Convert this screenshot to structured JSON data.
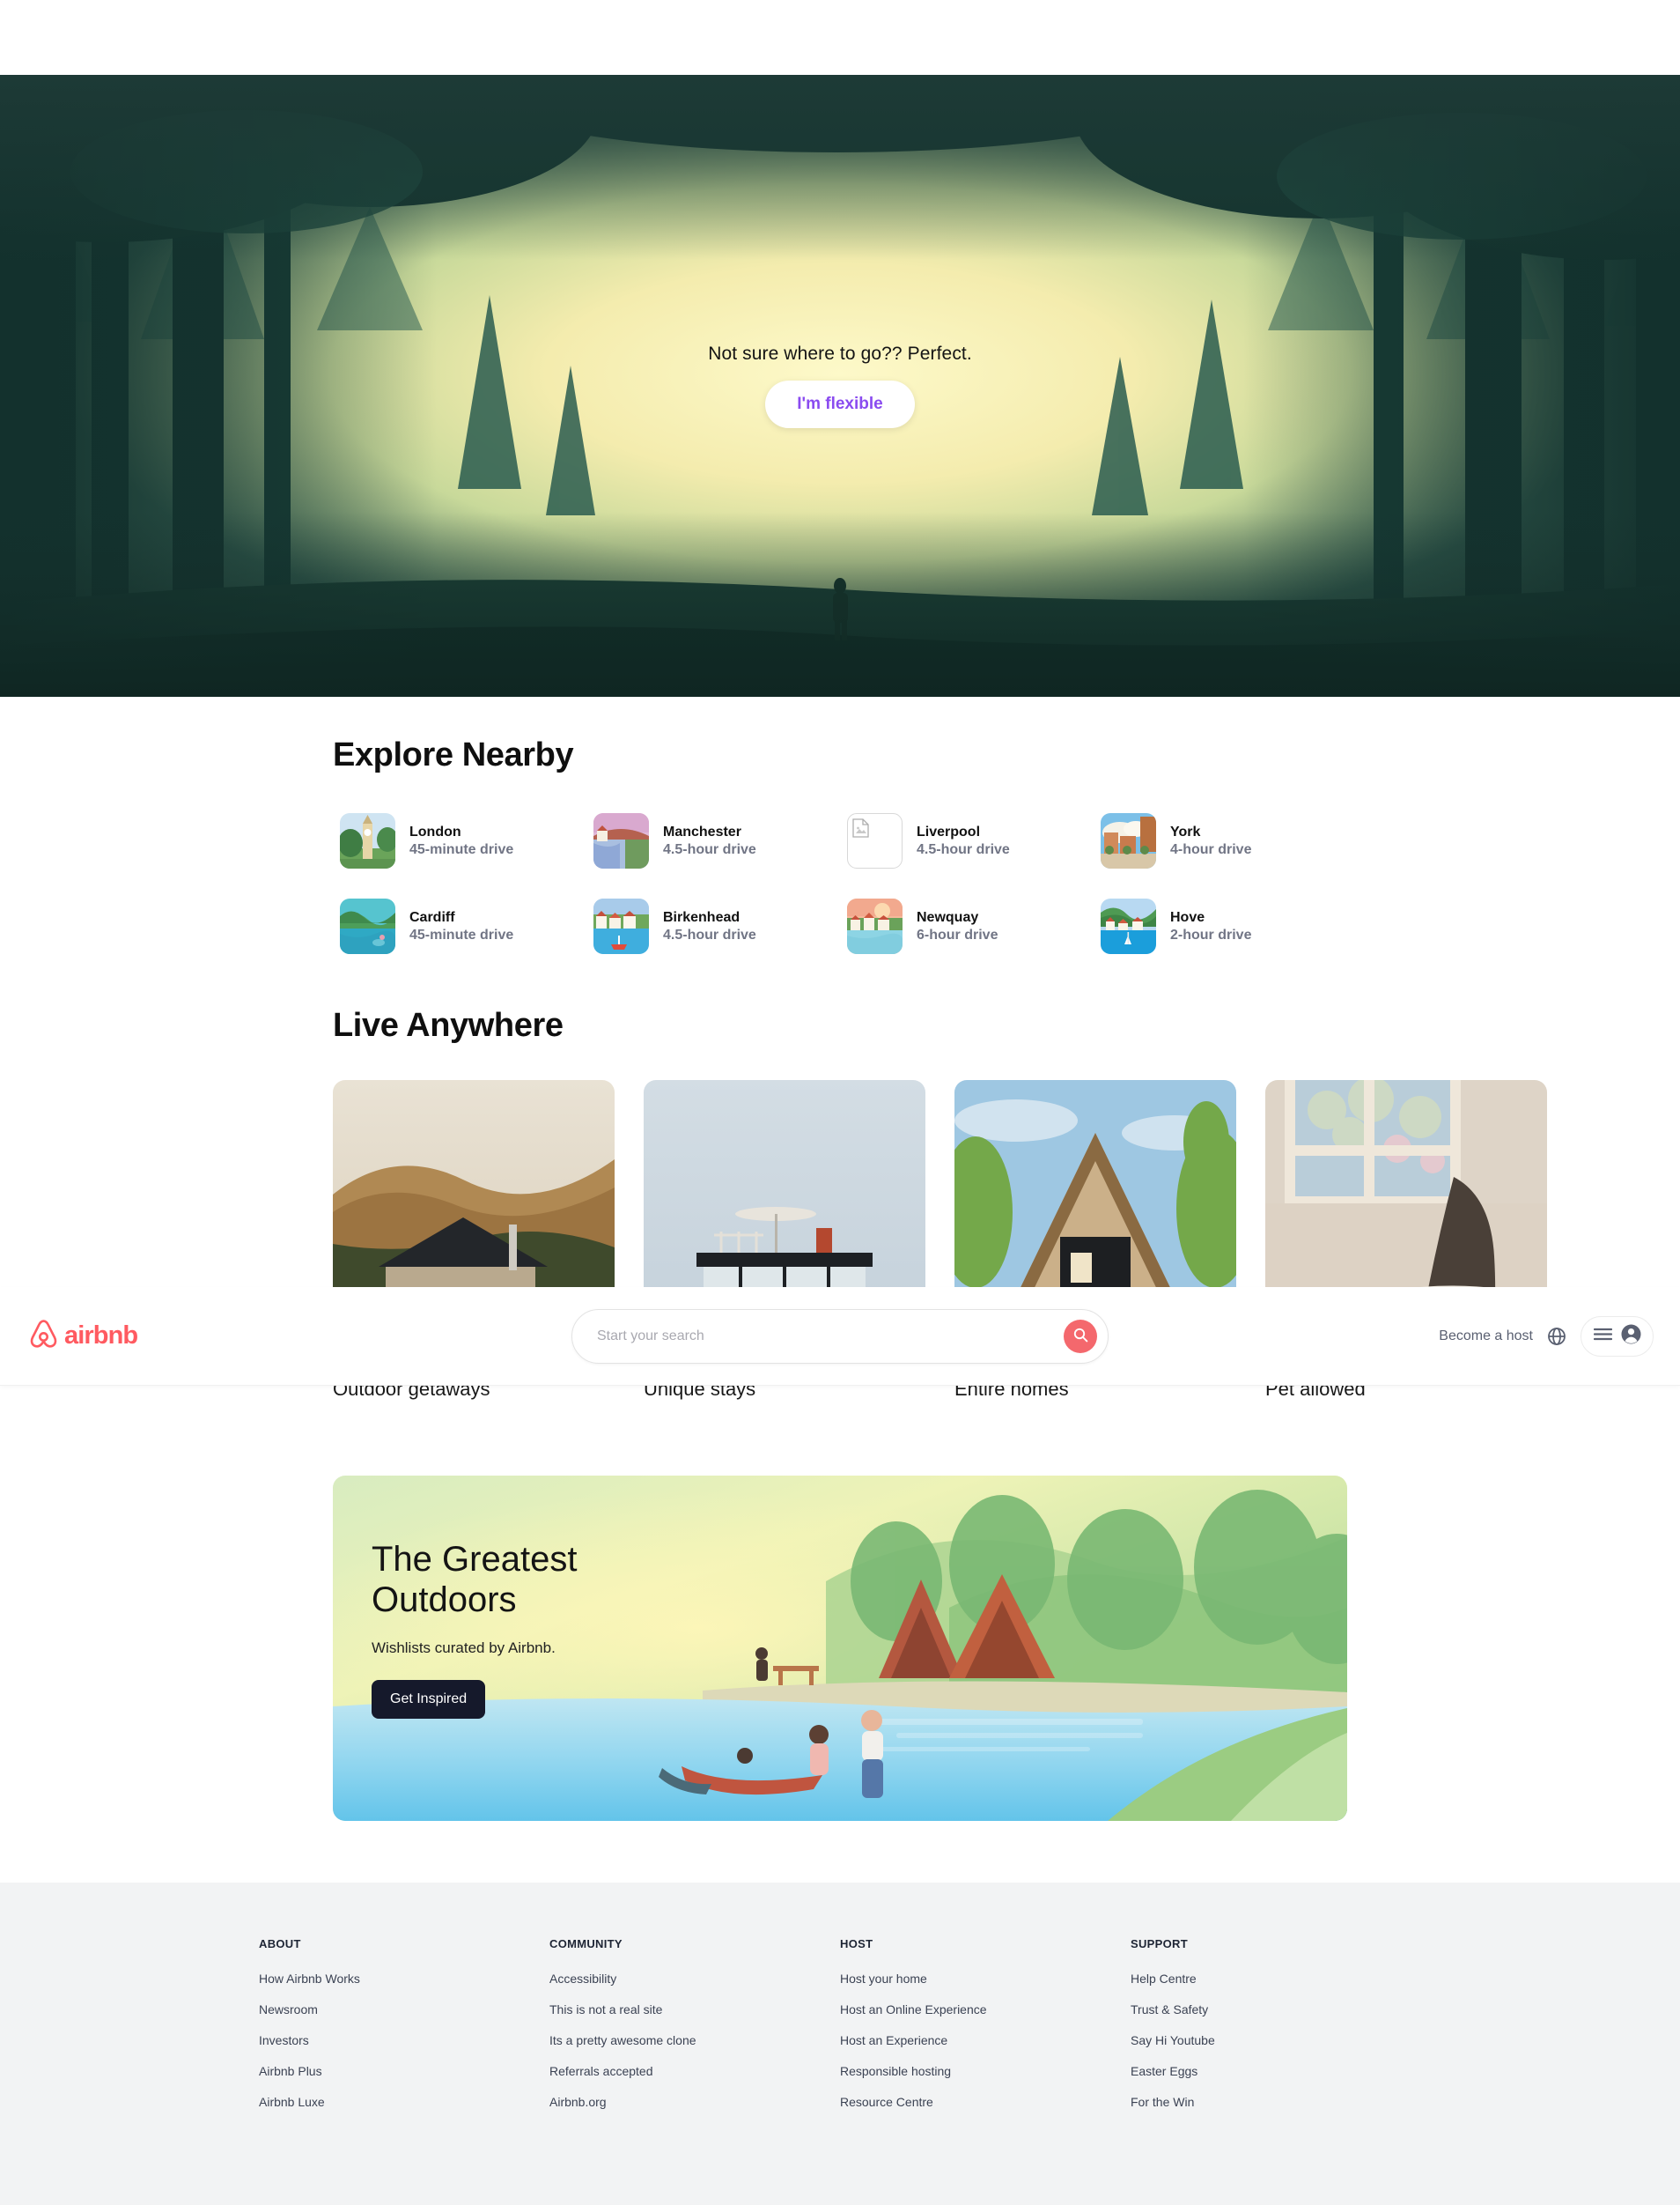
{
  "header": {
    "logo_word": "airbnb",
    "logo_icon": "airbnb-bel-logo-icon",
    "search_placeholder": "Start your search",
    "search_value": "",
    "search_icon": "search-icon",
    "become_host_label": "Become a host",
    "globe_icon": "globe-icon",
    "menu_icon": "hamburger-menu-icon",
    "avatar_icon": "user-avatar-icon",
    "accent_color": "#ff5a60",
    "search_button_color": "#f4686d"
  },
  "hero": {
    "tagline": "Not sure where to go?? Perfect.",
    "button_label": "I'm flexible",
    "button_text_color": "#8a4bf0",
    "art_name": "sunlit-forest-illustration"
  },
  "explore_nearby": {
    "title": "Explore Nearby",
    "cards": [
      {
        "city": "London",
        "distance": "45-minute drive",
        "thumb": "big-ben-thumb",
        "broken": false
      },
      {
        "city": "Manchester",
        "distance": "4.5-hour drive",
        "thumb": "bridge-river-thumb",
        "broken": false
      },
      {
        "city": "Liverpool",
        "distance": "4.5-hour drive",
        "thumb": "broken-image-icon",
        "broken": true
      },
      {
        "city": "York",
        "distance": "4-hour drive",
        "thumb": "old-town-square-thumb",
        "broken": false
      },
      {
        "city": "Cardiff",
        "distance": "45-minute drive",
        "thumb": "lake-hills-thumb",
        "broken": false
      },
      {
        "city": "Birkenhead",
        "distance": "4.5-hour drive",
        "thumb": "harbour-boat-thumb",
        "broken": false
      },
      {
        "city": "Newquay",
        "distance": "6-hour drive",
        "thumb": "sunset-village-thumb",
        "broken": false
      },
      {
        "city": "Hove",
        "distance": "2-hour drive",
        "thumb": "seaside-bay-thumb",
        "broken": false
      }
    ]
  },
  "live_anywhere": {
    "title": "Live Anywhere",
    "cards": [
      {
        "label": "Outdoor getaways",
        "image": "cabin-mountains-photo"
      },
      {
        "label": "Unique stays",
        "image": "modern-rooftop-house-photo"
      },
      {
        "label": "Entire homes",
        "image": "a-frame-cabin-photo"
      },
      {
        "label": "Pet allowed",
        "image": "bedroom-window-photo"
      }
    ]
  },
  "greatest_outdoors": {
    "title": "The Greatest Outdoors",
    "subtitle": "Wishlists curated by Airbnb.",
    "button_label": "Get Inspired",
    "art_name": "lakeside-camp-illustration"
  },
  "footer": {
    "columns": [
      {
        "heading": "ABOUT",
        "links": [
          "How Airbnb Works",
          "Newsroom",
          "Investors",
          "Airbnb Plus",
          "Airbnb Luxe"
        ]
      },
      {
        "heading": "COMMUNITY",
        "links": [
          "Accessibility",
          "This is not a real site",
          "Its a pretty awesome clone",
          "Referrals accepted",
          "Airbnb.org"
        ]
      },
      {
        "heading": "HOST",
        "links": [
          "Host your home",
          "Host an Online Experience",
          "Host an Experience",
          "Responsible hosting",
          "Resource Centre"
        ]
      },
      {
        "heading": "SUPPORT",
        "links": [
          "Help Centre",
          "Trust & Safety",
          "Say Hi Youtube",
          "Easter Eggs",
          "For the Win"
        ]
      }
    ]
  }
}
